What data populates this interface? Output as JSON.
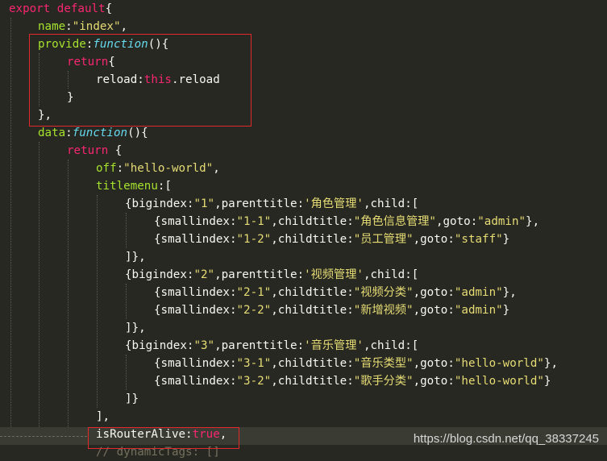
{
  "code_lines": [
    [
      [
        "kw",
        "export default"
      ],
      [
        "pl",
        "{"
      ]
    ],
    [
      [
        "key",
        "name"
      ],
      [
        "pl",
        ":"
      ],
      [
        "str",
        "\"index\""
      ],
      [
        "pl",
        ","
      ]
    ],
    [
      [
        "key",
        "provide"
      ],
      [
        "pl",
        ":"
      ],
      [
        "fn",
        "function"
      ],
      [
        "pl",
        "(){"
      ]
    ],
    [
      [
        "kw",
        "return"
      ],
      [
        "pl",
        "{"
      ]
    ],
    [
      [
        "id",
        "reload"
      ],
      [
        "pl",
        ":"
      ],
      [
        "kw",
        "this"
      ],
      [
        "pl",
        "."
      ],
      [
        "id",
        "reload"
      ]
    ],
    [
      [
        "pl",
        "}"
      ]
    ],
    [
      [
        "pl",
        "},"
      ]
    ],
    [
      [
        "key",
        "data"
      ],
      [
        "pl",
        ":"
      ],
      [
        "fn",
        "function"
      ],
      [
        "pl",
        "(){"
      ]
    ],
    [
      [
        "kw",
        "return"
      ],
      [
        "pl",
        " {"
      ]
    ],
    [
      [
        "key",
        "off"
      ],
      [
        "pl",
        ":"
      ],
      [
        "str",
        "\"hello-world\""
      ],
      [
        "pl",
        ","
      ]
    ],
    [
      [
        "key",
        "titlemenu"
      ],
      [
        "pl",
        ":["
      ]
    ],
    [
      [
        "pl",
        "{"
      ],
      [
        "id",
        "bigindex"
      ],
      [
        "pl",
        ":"
      ],
      [
        "str",
        "\"1\""
      ],
      [
        "pl",
        ","
      ],
      [
        "id",
        "parenttitle"
      ],
      [
        "pl",
        ":"
      ],
      [
        "str",
        "'角色管理'"
      ],
      [
        "pl",
        ","
      ],
      [
        "id",
        "child"
      ],
      [
        "pl",
        ":["
      ]
    ],
    [
      [
        "pl",
        "{"
      ],
      [
        "id",
        "smallindex"
      ],
      [
        "pl",
        ":"
      ],
      [
        "str",
        "\"1-1\""
      ],
      [
        "pl",
        ","
      ],
      [
        "id",
        "childtitle"
      ],
      [
        "pl",
        ":"
      ],
      [
        "str",
        "\"角色信息管理\""
      ],
      [
        "pl",
        ","
      ],
      [
        "id",
        "goto"
      ],
      [
        "pl",
        ":"
      ],
      [
        "str",
        "\"admin\""
      ],
      [
        "pl",
        "},"
      ]
    ],
    [
      [
        "pl",
        "{"
      ],
      [
        "id",
        "smallindex"
      ],
      [
        "pl",
        ":"
      ],
      [
        "str",
        "\"1-2\""
      ],
      [
        "pl",
        ","
      ],
      [
        "id",
        "childtitle"
      ],
      [
        "pl",
        ":"
      ],
      [
        "str",
        "\"员工管理\""
      ],
      [
        "pl",
        ","
      ],
      [
        "id",
        "goto"
      ],
      [
        "pl",
        ":"
      ],
      [
        "str",
        "\"staff\""
      ],
      [
        "pl",
        "}"
      ]
    ],
    [
      [
        "pl",
        "]},"
      ]
    ],
    [
      [
        "pl",
        "{"
      ],
      [
        "id",
        "bigindex"
      ],
      [
        "pl",
        ":"
      ],
      [
        "str",
        "\"2\""
      ],
      [
        "pl",
        ","
      ],
      [
        "id",
        "parenttitle"
      ],
      [
        "pl",
        ":"
      ],
      [
        "str",
        "'视频管理'"
      ],
      [
        "pl",
        ","
      ],
      [
        "id",
        "child"
      ],
      [
        "pl",
        ":["
      ]
    ],
    [
      [
        "pl",
        "{"
      ],
      [
        "id",
        "smallindex"
      ],
      [
        "pl",
        ":"
      ],
      [
        "str",
        "\"2-1\""
      ],
      [
        "pl",
        ","
      ],
      [
        "id",
        "childtitle"
      ],
      [
        "pl",
        ":"
      ],
      [
        "str",
        "\"视频分类\""
      ],
      [
        "pl",
        ","
      ],
      [
        "id",
        "goto"
      ],
      [
        "pl",
        ":"
      ],
      [
        "str",
        "\"admin\""
      ],
      [
        "pl",
        "},"
      ]
    ],
    [
      [
        "pl",
        "{"
      ],
      [
        "id",
        "smallindex"
      ],
      [
        "pl",
        ":"
      ],
      [
        "str",
        "\"2-2\""
      ],
      [
        "pl",
        ","
      ],
      [
        "id",
        "childtitle"
      ],
      [
        "pl",
        ":"
      ],
      [
        "str",
        "\"新增视频\""
      ],
      [
        "pl",
        ","
      ],
      [
        "id",
        "goto"
      ],
      [
        "pl",
        ":"
      ],
      [
        "str",
        "\"admin\""
      ],
      [
        "pl",
        "}"
      ]
    ],
    [
      [
        "pl",
        "]},"
      ]
    ],
    [
      [
        "pl",
        "{"
      ],
      [
        "id",
        "bigindex"
      ],
      [
        "pl",
        ":"
      ],
      [
        "str",
        "\"3\""
      ],
      [
        "pl",
        ","
      ],
      [
        "id",
        "parenttitle"
      ],
      [
        "pl",
        ":"
      ],
      [
        "str",
        "'音乐管理'"
      ],
      [
        "pl",
        ","
      ],
      [
        "id",
        "child"
      ],
      [
        "pl",
        ":["
      ]
    ],
    [
      [
        "pl",
        "{"
      ],
      [
        "id",
        "smallindex"
      ],
      [
        "pl",
        ":"
      ],
      [
        "str",
        "\"3-1\""
      ],
      [
        "pl",
        ","
      ],
      [
        "id",
        "childtitle"
      ],
      [
        "pl",
        ":"
      ],
      [
        "str",
        "\"音乐类型\""
      ],
      [
        "pl",
        ","
      ],
      [
        "id",
        "goto"
      ],
      [
        "pl",
        ":"
      ],
      [
        "str",
        "\"hello-world\""
      ],
      [
        "pl",
        "},"
      ]
    ],
    [
      [
        "pl",
        "{"
      ],
      [
        "id",
        "smallindex"
      ],
      [
        "pl",
        ":"
      ],
      [
        "str",
        "\"3-2\""
      ],
      [
        "pl",
        ","
      ],
      [
        "id",
        "childtitle"
      ],
      [
        "pl",
        ":"
      ],
      [
        "str",
        "\"歌手分类\""
      ],
      [
        "pl",
        ","
      ],
      [
        "id",
        "goto"
      ],
      [
        "pl",
        ":"
      ],
      [
        "str",
        "\"hello-world\""
      ],
      [
        "pl",
        "}"
      ]
    ],
    [
      [
        "pl",
        "]}"
      ]
    ],
    [
      [
        "pl",
        "],"
      ]
    ],
    [
      [
        "id",
        "isRouterAlive"
      ],
      [
        "pl",
        ":"
      ],
      [
        "kw",
        "true"
      ],
      [
        "pl",
        ","
      ]
    ],
    [
      [
        "pl",
        "// dynamicTags: []"
      ]
    ]
  ],
  "watermark": "https://blog.csdn.net/qq_38337245",
  "colors": {
    "background": "#272822",
    "keyword": "#f92672",
    "function": "#66d9ef",
    "string": "#e6db74",
    "property": "#a6e22e",
    "text": "#f8f8f2",
    "highlight_box": "#e0282d"
  }
}
